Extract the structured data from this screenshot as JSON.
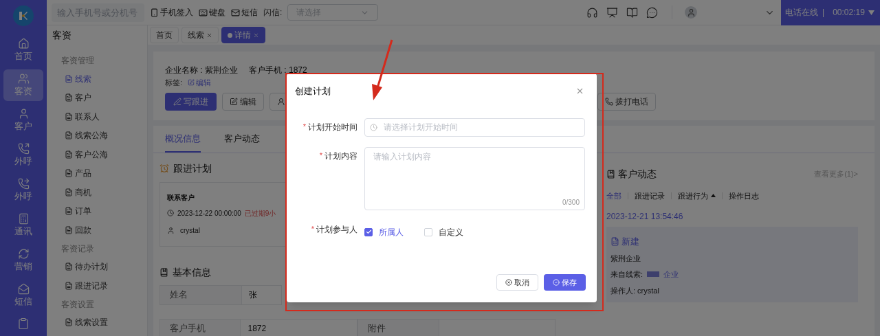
{
  "nav": {
    "items": [
      {
        "label": "首页",
        "selected": false
      },
      {
        "label": "客资",
        "selected": true
      },
      {
        "label": "客户",
        "selected": false
      },
      {
        "label": "外呼",
        "selected": false
      },
      {
        "label": "外呼",
        "selected": false
      },
      {
        "label": "通讯",
        "selected": false
      },
      {
        "label": "营销",
        "selected": false
      },
      {
        "label": "短信",
        "selected": false
      }
    ]
  },
  "topbar": {
    "search_placeholder": "输入手机号或分机号",
    "actions": [
      "手机签入",
      "键盘",
      "短信"
    ],
    "flash_label": "闪信:",
    "flash_placeholder": "请选择",
    "status": "电话在线",
    "status_sep": "|",
    "timer": "00:02:19"
  },
  "page_tabs": [
    {
      "label": "首页",
      "closable": false,
      "selected": false
    },
    {
      "label": "线索",
      "closable": true,
      "selected": false
    },
    {
      "label": "详情",
      "closable": true,
      "selected": true
    }
  ],
  "sidebar": {
    "title": "客资",
    "groups": [
      {
        "title": "客资管理",
        "items": [
          {
            "label": "线索",
            "selected": true
          },
          {
            "label": "客户",
            "selected": false
          },
          {
            "label": "联系人",
            "selected": false
          },
          {
            "label": "线索公海",
            "selected": false
          },
          {
            "label": "客户公海",
            "selected": false
          },
          {
            "label": "产品",
            "selected": false
          },
          {
            "label": "商机",
            "selected": false
          },
          {
            "label": "订单",
            "selected": false
          },
          {
            "label": "回款",
            "selected": false
          }
        ]
      },
      {
        "title": "客资记录",
        "items": [
          {
            "label": "待办计划",
            "selected": false
          },
          {
            "label": "跟进记录",
            "selected": false
          }
        ]
      },
      {
        "title": "客资设置",
        "items": [
          {
            "label": "线索设置",
            "selected": false
          }
        ]
      }
    ]
  },
  "header": {
    "company_label": "企业名称 : 紫荆企业",
    "phone_label": "客户手机 : 1872",
    "tags_label": "标签:",
    "tags_edit": "编辑",
    "buttons": [
      {
        "label": "写跟进",
        "kind": "primary"
      },
      {
        "label": "编辑",
        "kind": "edit"
      },
      {
        "kind": "user"
      }
    ],
    "call_button": "拨打电话"
  },
  "detail_tabs": [
    {
      "label": "概况信息",
      "selected": true
    },
    {
      "label": "客户动态",
      "selected": false
    }
  ],
  "follow_plan": {
    "title": "跟进计划",
    "item_title": "联系客户",
    "time": "2023-12-22 00:00:00",
    "overdue": "已过期9小",
    "owner": "crystal"
  },
  "basic_info": {
    "title": "基本信息",
    "rows": [
      [
        {
          "label": "姓名",
          "value": "张"
        }
      ],
      [
        {
          "label": "客户手机",
          "value": "1872"
        },
        {
          "label": "附件"
        }
      ]
    ]
  },
  "activity": {
    "title": "客户动态",
    "more": "查看更多(1)>",
    "filters": [
      {
        "label": "全部",
        "selected": true,
        "caret": false
      },
      {
        "label": "跟进记录",
        "selected": false,
        "caret": false
      },
      {
        "label": "跟进行为",
        "selected": false,
        "caret": true
      },
      {
        "label": "操作日志",
        "selected": false,
        "caret": false
      }
    ],
    "date": "2023-12-21 13:54:46",
    "event": {
      "title": "新建",
      "company": "紫荆企业",
      "source_label": "来自线索:",
      "source_link": "企业",
      "operator": "操作人: crystal"
    }
  },
  "modal": {
    "title": "创建计划",
    "fields": [
      {
        "kind": "time",
        "mark": "*",
        "label": "计划开始时间",
        "placeholder": "请选择计划开始时间"
      },
      {
        "kind": "textarea",
        "mark": "*",
        "label": "计划内容",
        "placeholder": "请输入计划内容",
        "counter": "0/300"
      },
      {
        "kind": "checkboxes",
        "mark": "*",
        "label": "计划参与人",
        "options": [
          {
            "label": "所属人",
            "checked": true
          },
          {
            "label": "自定义",
            "checked": false
          }
        ]
      }
    ],
    "buttons": [
      {
        "label": "取消",
        "kind": "cancel"
      },
      {
        "label": "保存",
        "kind": "save"
      }
    ]
  }
}
